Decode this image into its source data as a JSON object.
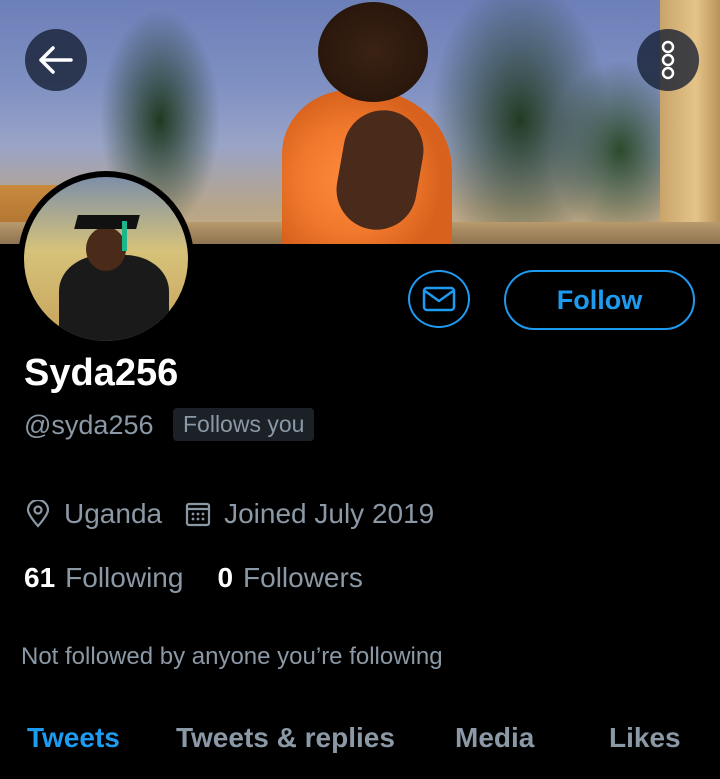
{
  "header": {
    "back_icon": "arrow-left-icon",
    "more_icon": "more-vertical-icon"
  },
  "profile": {
    "display_name": "Syda256",
    "handle": "@syda256",
    "follows_you": "Follows you",
    "location": "Uganda",
    "joined": "Joined July 2019",
    "following_count": "61",
    "following_label": "Following",
    "followers_count": "0",
    "followers_label": "Followers",
    "mutuals_text": "Not followed by anyone you’re following"
  },
  "actions": {
    "message_icon": "envelope-icon",
    "follow_label": "Follow"
  },
  "tabs": [
    {
      "label": "Tweets",
      "active": true
    },
    {
      "label": "Tweets & replies",
      "active": false
    },
    {
      "label": "Media",
      "active": false
    },
    {
      "label": "Likes",
      "active": false
    }
  ],
  "colors": {
    "accent": "#1d9bf0",
    "muted_text": "#8b98a5",
    "background": "#000000"
  }
}
